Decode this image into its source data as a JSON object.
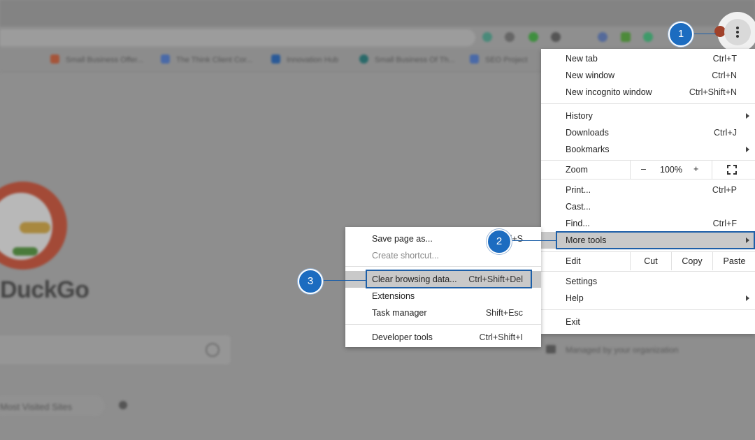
{
  "background": {
    "bookmarks": [
      "Small Business Offer...",
      "The Think Client Cor...",
      "Innovation Hub",
      "Small Business Of Th...",
      "SEO Project"
    ],
    "brand_text": "DuckGo",
    "favorites_label": "Most Visited Sites",
    "managed_label": "Managed by your organization"
  },
  "menu": {
    "new_tab": {
      "label": "New tab",
      "shortcut": "Ctrl+T"
    },
    "new_window": {
      "label": "New window",
      "shortcut": "Ctrl+N"
    },
    "new_incognito": {
      "label": "New incognito window",
      "shortcut": "Ctrl+Shift+N"
    },
    "history": {
      "label": "History"
    },
    "downloads": {
      "label": "Downloads",
      "shortcut": "Ctrl+J"
    },
    "bookmarks": {
      "label": "Bookmarks"
    },
    "zoom": {
      "label": "Zoom",
      "minus": "–",
      "value": "100%",
      "plus": "+"
    },
    "print": {
      "label": "Print...",
      "shortcut": "Ctrl+P"
    },
    "cast": {
      "label": "Cast..."
    },
    "find": {
      "label": "Find...",
      "shortcut": "Ctrl+F"
    },
    "more_tools": {
      "label": "More tools"
    },
    "edit": {
      "label": "Edit",
      "cut": "Cut",
      "copy": "Copy",
      "paste": "Paste"
    },
    "settings": {
      "label": "Settings"
    },
    "help": {
      "label": "Help"
    },
    "exit": {
      "label": "Exit"
    }
  },
  "submenu": {
    "save_page": {
      "label": "Save page as...",
      "shortcut": "Ctrl+S"
    },
    "create_shortcut": {
      "label": "Create shortcut..."
    },
    "clear_data": {
      "label": "Clear browsing data...",
      "shortcut": "Ctrl+Shift+Del"
    },
    "extensions": {
      "label": "Extensions"
    },
    "task_manager": {
      "label": "Task manager",
      "shortcut": "Shift+Esc"
    },
    "dev_tools": {
      "label": "Developer tools",
      "shortcut": "Ctrl+Shift+I"
    }
  },
  "callouts": {
    "step1": "1",
    "step2": "2",
    "step3": "3"
  },
  "colors": {
    "callout_blue": "#1c6cc0",
    "highlight_gray": "#c9c9c9"
  }
}
